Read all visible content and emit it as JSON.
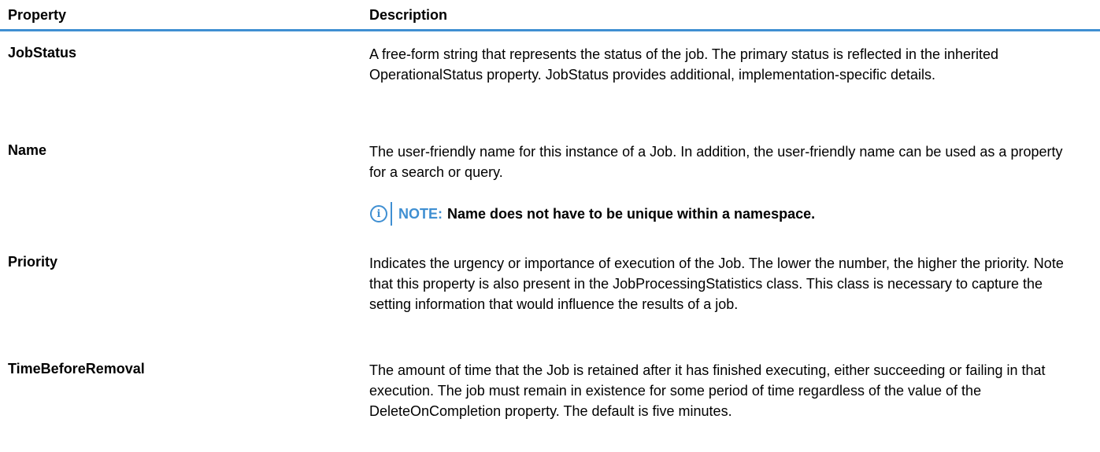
{
  "table": {
    "headers": {
      "property": "Property",
      "description": "Description"
    },
    "rows": [
      {
        "property": "JobStatus",
        "description": "A free-form string that represents the status of the job. The primary status is reflected in the inherited OperationalStatus property. JobStatus provides additional, implementation-specific details."
      },
      {
        "property": "Name",
        "description": "The user-friendly name for this instance of a Job. In addition, the user-friendly name can be used as a property for a search or query.",
        "note": {
          "icon": "info-icon",
          "label": "NOTE:",
          "text": "Name does not have to be unique within a namespace."
        }
      },
      {
        "property": "Priority",
        "description": "Indicates the urgency or importance of execution of the Job. The lower the number, the higher the priority. Note that this property is also present in the JobProcessingStatistics class. This class is necessary to capture the setting information that would influence the results of a job."
      },
      {
        "property": "TimeBeforeRemoval",
        "description": "The amount of time that the Job is retained after it has finished executing, either succeeding or failing in that execution. The job must remain in existence for some period of time regardless of the value of the DeleteOnCompletion property. The default is five minutes."
      }
    ]
  },
  "colors": {
    "accent": "#3f8fd2",
    "text": "#000000"
  }
}
